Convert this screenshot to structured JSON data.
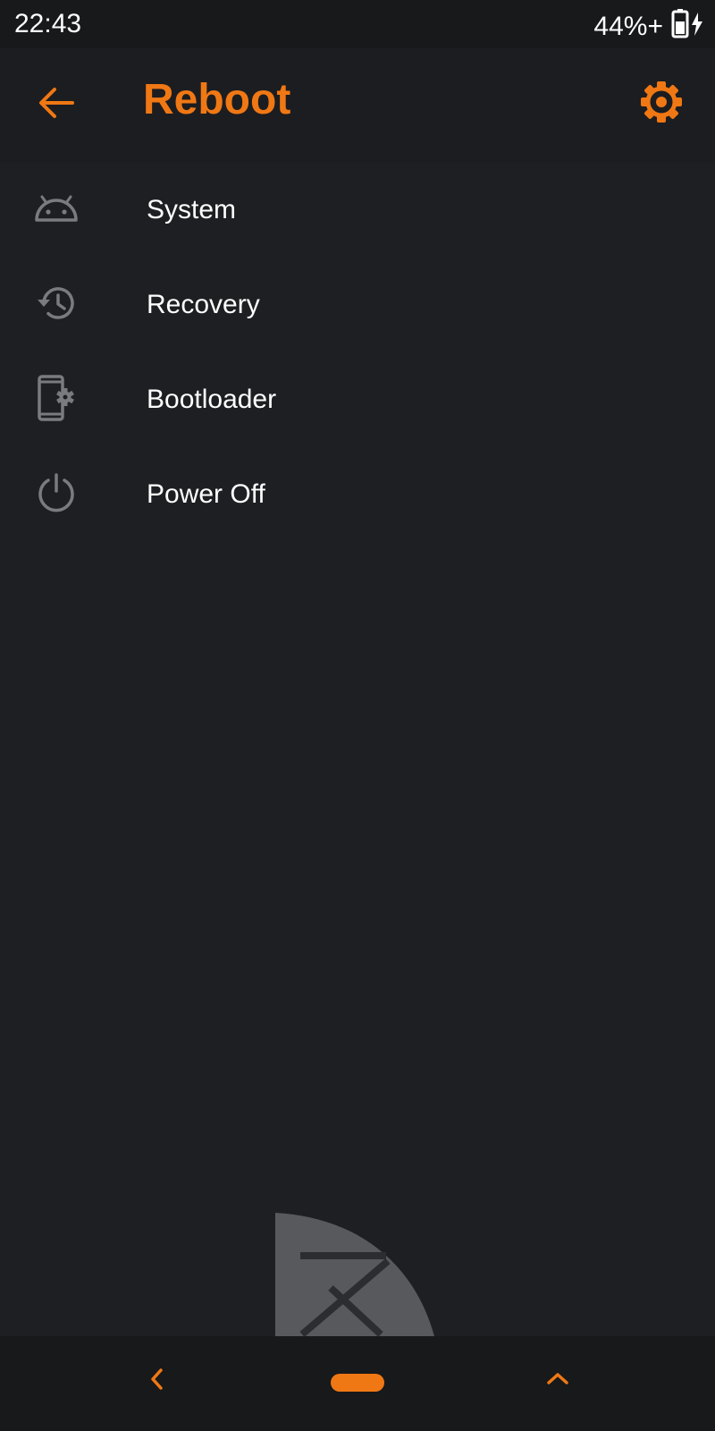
{
  "status_bar": {
    "time": "22:43",
    "battery_text": "44%+",
    "battery_icon": "battery-charging-icon"
  },
  "app_bar": {
    "title": "Reboot",
    "back_icon": "arrow-back-icon",
    "settings_icon": "gear-icon"
  },
  "menu": {
    "items": [
      {
        "label": "System",
        "icon": "android-icon"
      },
      {
        "label": "Recovery",
        "icon": "history-icon"
      },
      {
        "label": "Bootloader",
        "icon": "phone-settings-icon"
      },
      {
        "label": "Power Off",
        "icon": "power-icon"
      }
    ]
  },
  "nav_bar": {
    "back_icon": "chevron-left-icon",
    "home_icon": "home-pill-icon",
    "up_icon": "chevron-up-icon"
  },
  "colors": {
    "accent": "#f07814",
    "background": "#1e1f22",
    "icon_gray": "#7a7b7e",
    "text": "#ffffff"
  }
}
